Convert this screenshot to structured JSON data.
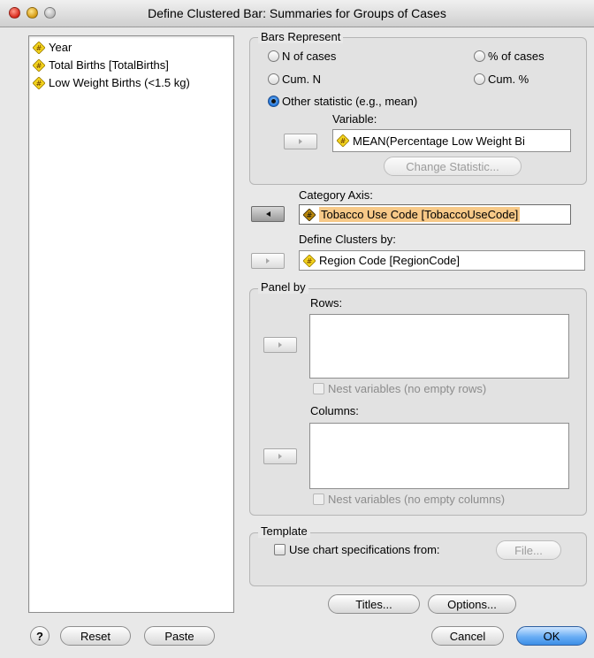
{
  "window": {
    "title": "Define Clustered Bar: Summaries for Groups of Cases"
  },
  "variables": [
    {
      "label": "Year",
      "icon": "scale-icon"
    },
    {
      "label": "Total Births [TotalBirths]",
      "icon": "scale-icon"
    },
    {
      "label": "Low Weight Births (<1.5 kg)",
      "icon": "scale-icon"
    }
  ],
  "bars_represent": {
    "title": "Bars Represent",
    "options": {
      "n_cases": "N of cases",
      "pct_cases": "% of cases",
      "cum_n": "Cum. N",
      "cum_pct": "Cum. %",
      "other": "Other statistic (e.g., mean)"
    },
    "selected": "other",
    "variable_label": "Variable:",
    "variable_value": "MEAN(Percentage Low Weight Bi",
    "change_statistic": "Change Statistic..."
  },
  "category_axis": {
    "label": "Category Axis:",
    "value": "Tobacco Use Code [TobaccoUseCode]"
  },
  "define_clusters": {
    "label": "Define Clusters by:",
    "value": "Region Code [RegionCode]"
  },
  "panel_by": {
    "title": "Panel by",
    "rows_label": "Rows:",
    "nest_rows": "Nest variables (no empty rows)",
    "columns_label": "Columns:",
    "nest_columns": "Nest variables (no empty columns)"
  },
  "template": {
    "title": "Template",
    "use_chart_specs": "Use chart specifications from:",
    "file_button": "File..."
  },
  "buttons": {
    "titles": "Titles...",
    "options": "Options...",
    "help": "?",
    "reset": "Reset",
    "paste": "Paste",
    "cancel": "Cancel",
    "ok": "OK"
  },
  "colors": {
    "selection": "#f7c988",
    "default_button": "#3d8ee6",
    "scale_icon": "#f2d21c"
  }
}
